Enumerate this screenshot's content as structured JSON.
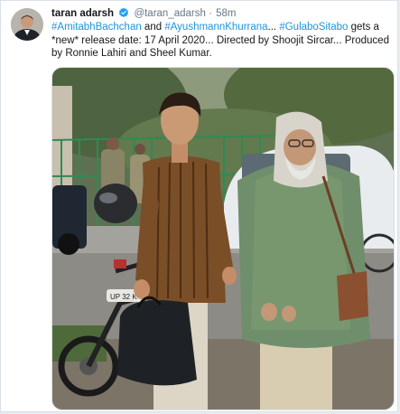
{
  "tweet": {
    "author_name": "taran adarsh",
    "handle": "@taran_adarsh",
    "separator": "·",
    "time": "58m",
    "hashtag1": "#AmitabhBachchan",
    "word_and": " and ",
    "hashtag2": "#AyushmannKhurrana",
    "dots": "... ",
    "hashtag3": "#GulaboSitabo",
    "body_rest": " gets a *new* release date: 17 April 2020... Directed by Shoojit Sircar... Produced by Ronnie Lahiri and Sheel Kumar.",
    "plate_text": "UP 32 K"
  },
  "colors": {
    "link": "#1b95e0",
    "verified": "#1da1f2",
    "secondary_text": "#657786"
  },
  "icons": {
    "verified": "verified-badge-icon"
  }
}
